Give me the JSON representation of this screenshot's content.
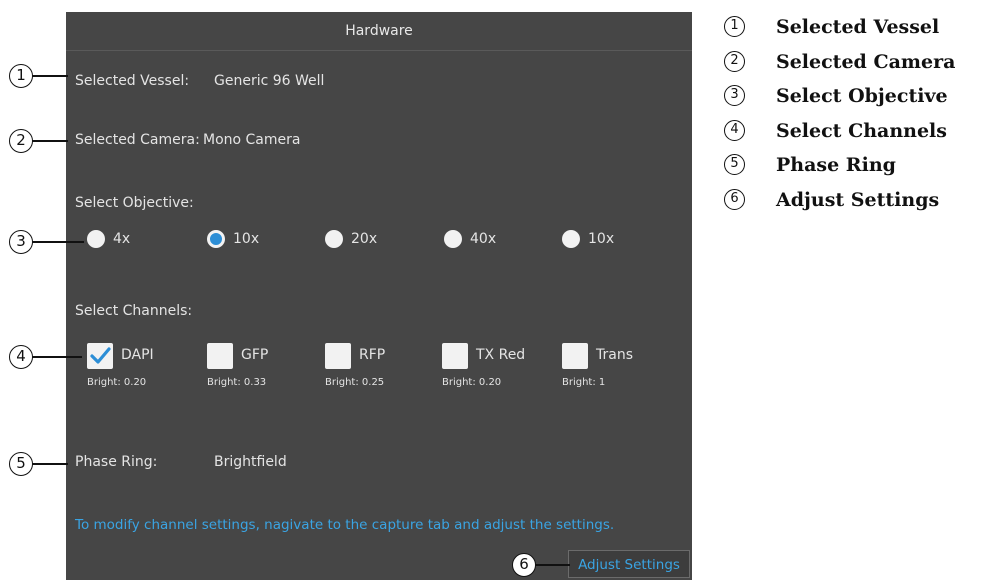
{
  "panel": {
    "title": "Hardware",
    "vessel": {
      "label": "Selected Vessel:",
      "value": "Generic 96 Well"
    },
    "camera": {
      "label": "Selected Camera:",
      "value": "Mono Camera"
    },
    "objective": {
      "label": "Select Objective:",
      "options": [
        {
          "label": "4x",
          "selected": false
        },
        {
          "label": "10x",
          "selected": true
        },
        {
          "label": "20x",
          "selected": false
        },
        {
          "label": "40x",
          "selected": false
        },
        {
          "label": "10x",
          "selected": false
        }
      ]
    },
    "channels": {
      "label": "Select Channels:",
      "items": [
        {
          "label": "DAPI",
          "checked": true,
          "bright": "Bright: 0.20"
        },
        {
          "label": "GFP",
          "checked": false,
          "bright": "Bright: 0.33"
        },
        {
          "label": "RFP",
          "checked": false,
          "bright": "Bright: 0.25"
        },
        {
          "label": "TX Red",
          "checked": false,
          "bright": "Bright: 0.20"
        },
        {
          "label": "Trans",
          "checked": false,
          "bright": "Bright: 1"
        }
      ]
    },
    "phase_ring": {
      "label": "Phase Ring:",
      "value": "Brightfield"
    },
    "hint": "To modify channel settings, nagivate to the capture tab and adjust the settings.",
    "adjust_button": "Adjust Settings"
  },
  "callouts": [
    "1",
    "2",
    "3",
    "4",
    "5",
    "6"
  ],
  "legend": [
    {
      "num": "1",
      "label": "Selected Vessel"
    },
    {
      "num": "2",
      "label": "Selected Camera"
    },
    {
      "num": "3",
      "label": "Select Objective"
    },
    {
      "num": "4",
      "label": "Select Channels"
    },
    {
      "num": "5",
      "label": "Phase Ring"
    },
    {
      "num": "6",
      "label": "Adjust Settings"
    }
  ],
  "colors": {
    "panel_bg": "#464646",
    "accent": "#2c8ed6",
    "link_text": "#3aa4e3"
  },
  "icons": {
    "checkmark": "check-icon",
    "radio": "radio-button"
  }
}
